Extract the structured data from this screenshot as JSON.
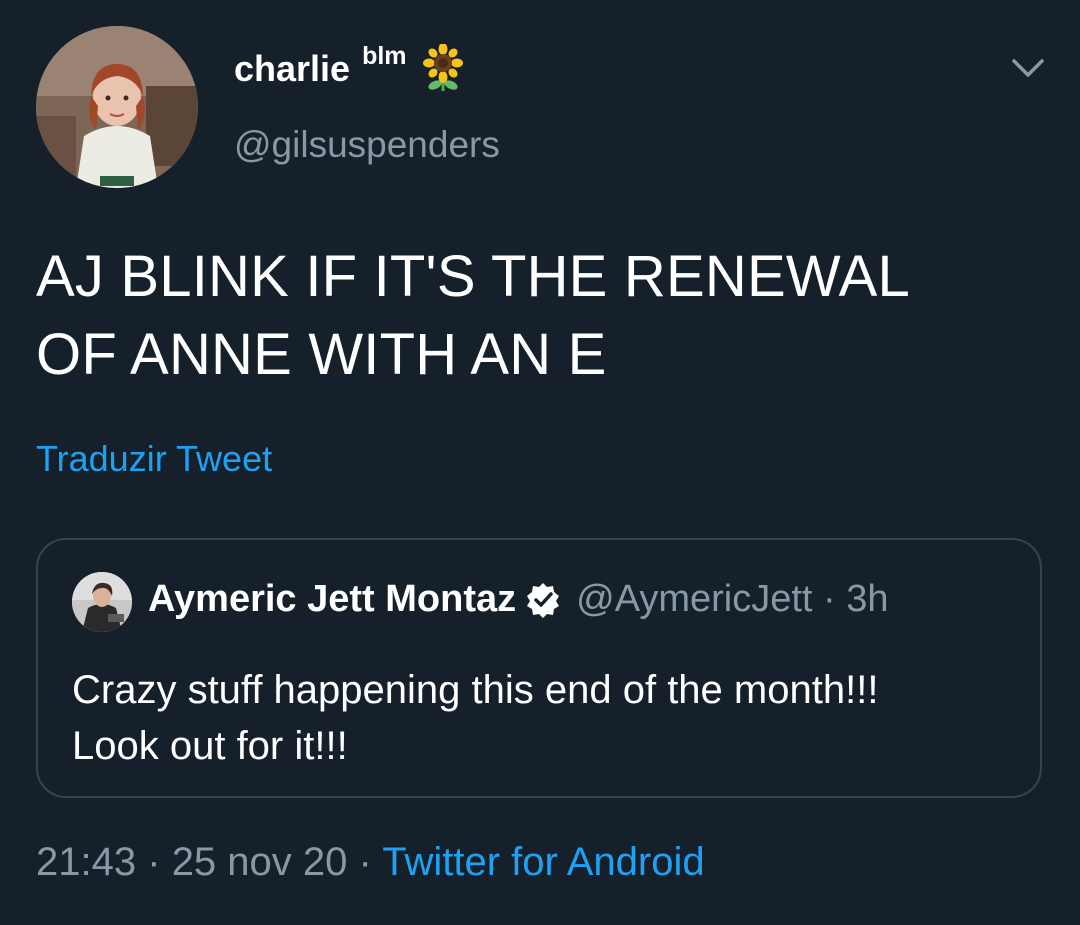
{
  "author": {
    "display_name": "charlie",
    "name_suffix": "blm",
    "emoji_icon": "sunflower-icon",
    "handle": "@gilsuspenders"
  },
  "tweet": {
    "text": "AJ BLINK IF IT'S THE RENEWAL\nOF ANNE WITH AN E",
    "translate_label": "Traduzir Tweet"
  },
  "quoted_tweet": {
    "display_name": "Aymeric Jett Montaz",
    "verified": true,
    "handle_and_time": "@AymericJett · 3h",
    "text": "Crazy stuff happening this end of the month!!!\nLook out for it!!!"
  },
  "meta": {
    "time": "21:43",
    "separator": "·",
    "date": "25 nov 20",
    "source": "Twitter for Android"
  },
  "colors": {
    "background": "#15202b",
    "secondary_text": "#8899a6",
    "link": "#1da1f2",
    "border": "#38444d"
  }
}
